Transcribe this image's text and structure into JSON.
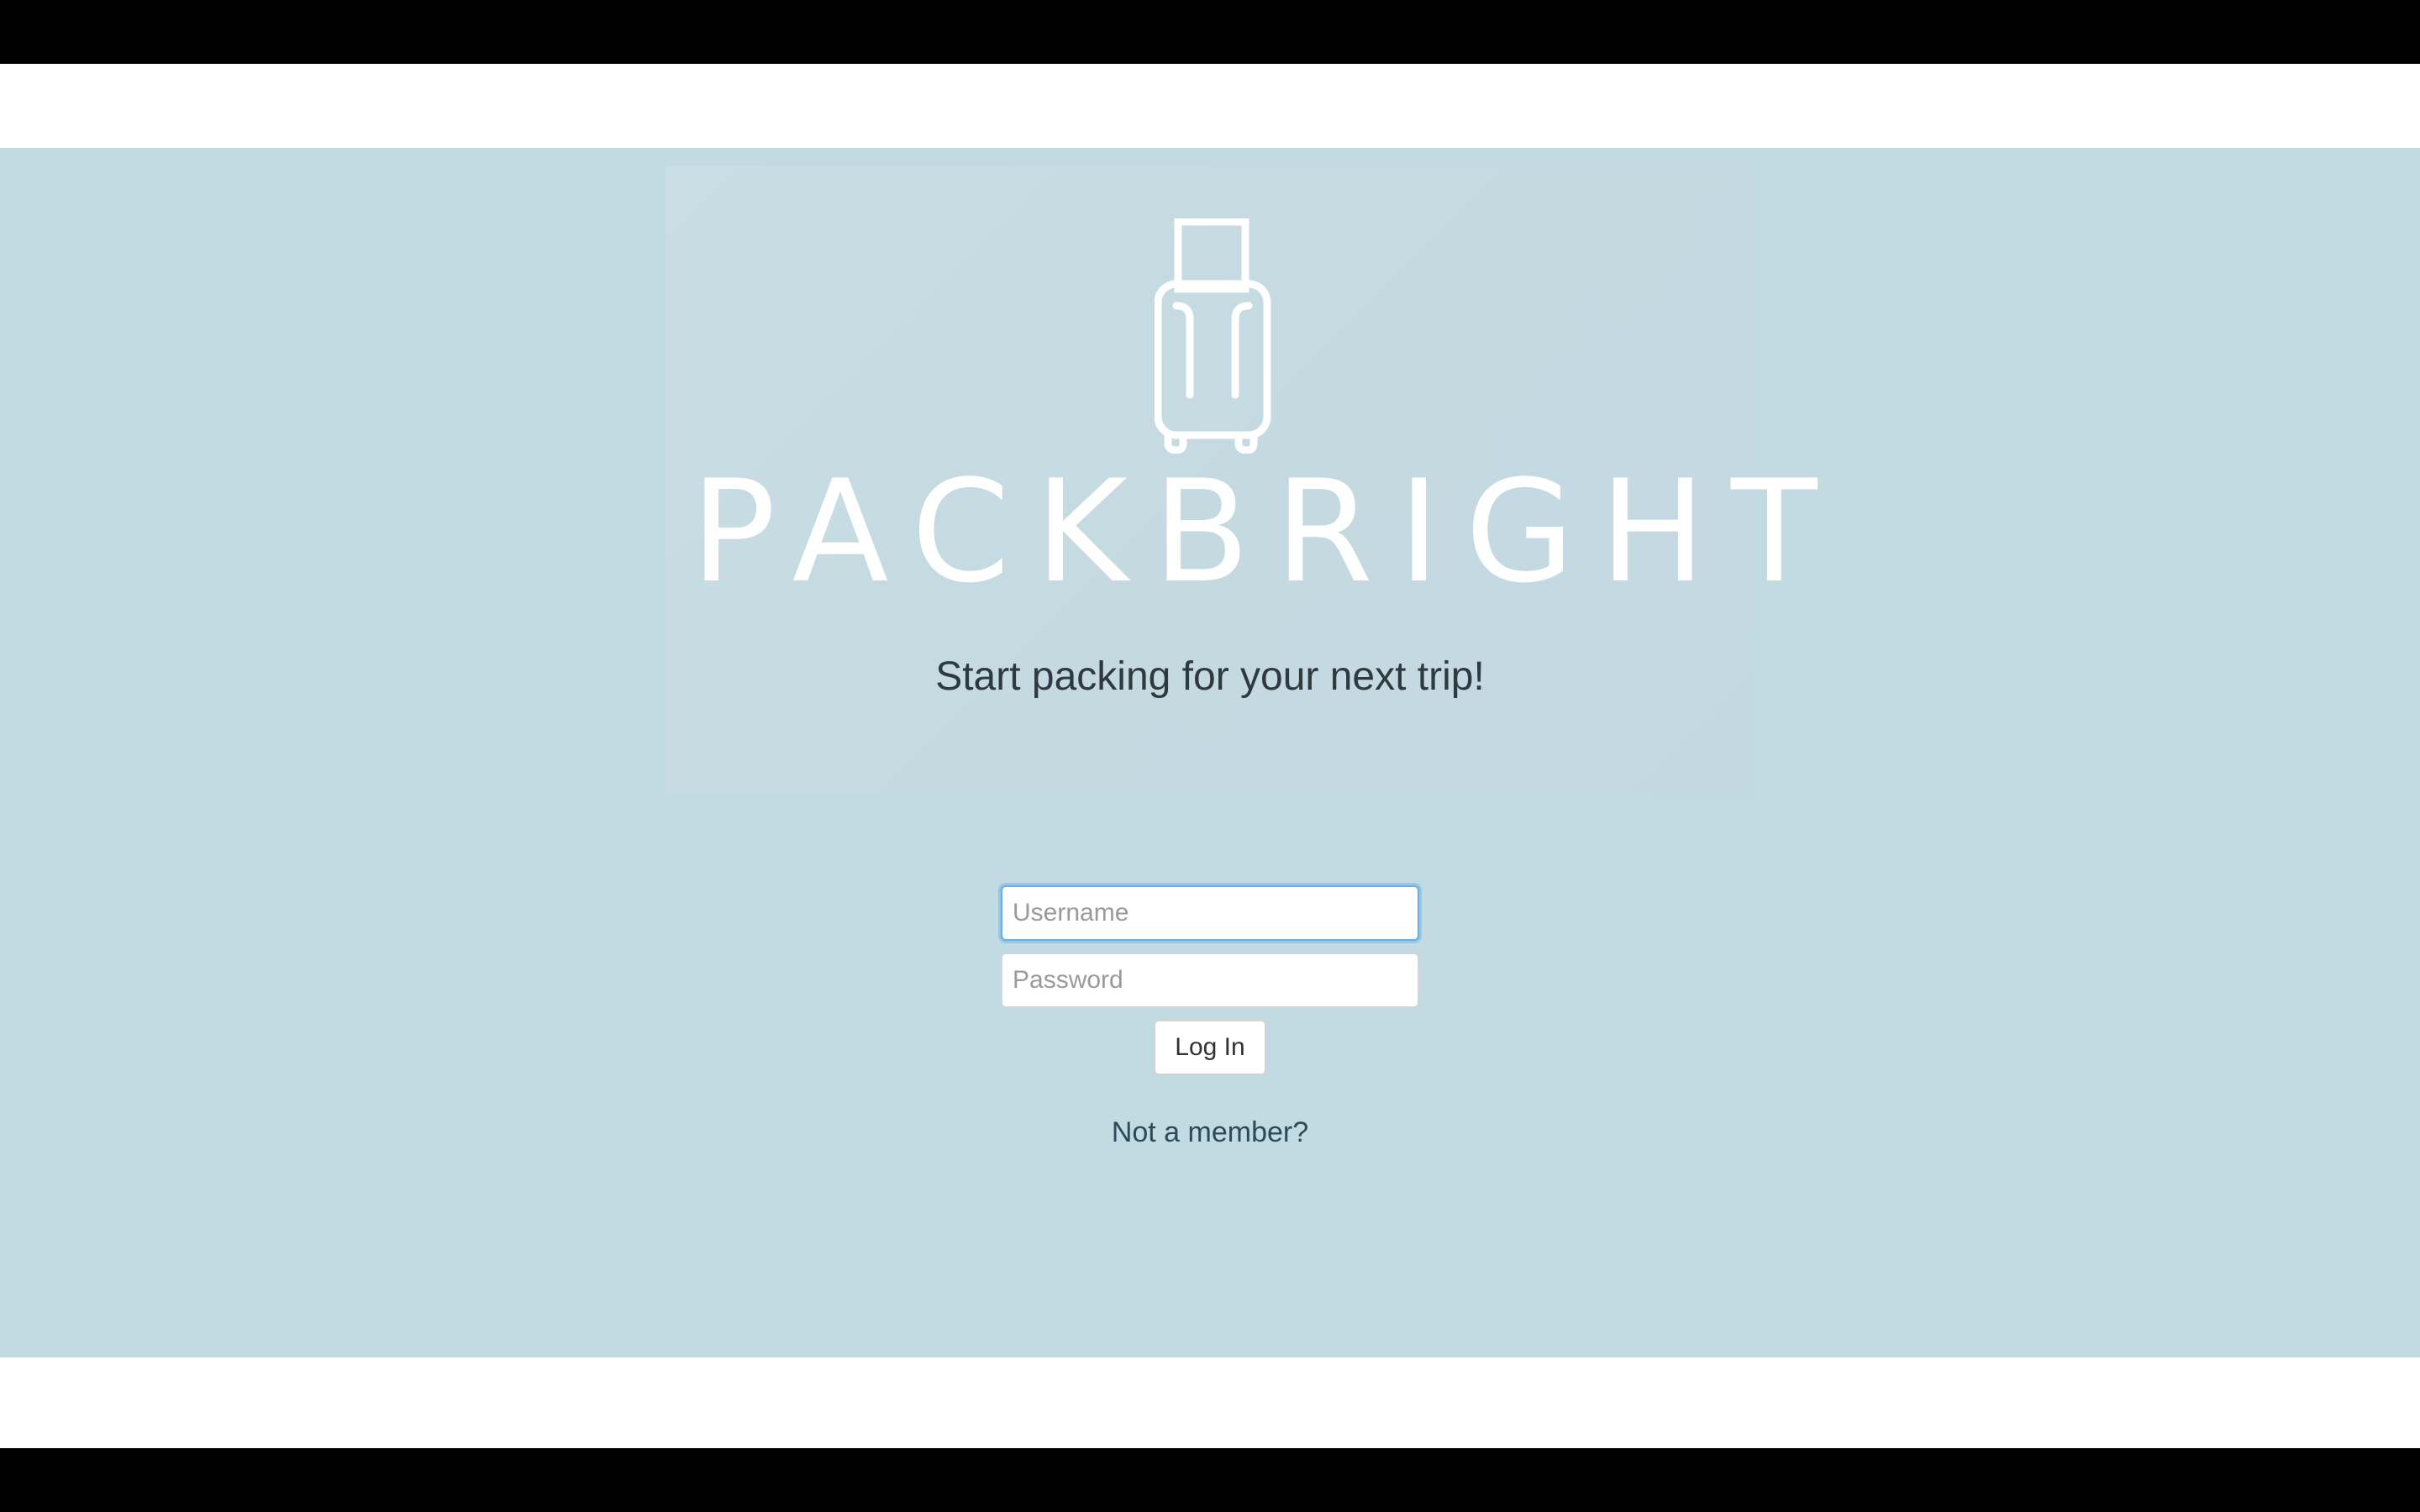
{
  "brand": {
    "name": "PACKBRIGHT",
    "logo_icon": "suitcase-icon"
  },
  "hero": {
    "tagline": "Start packing for your next trip!"
  },
  "login_form": {
    "username_placeholder": "Username",
    "password_placeholder": "Password",
    "submit_label": "Log In",
    "signup_link": "Not a member?"
  },
  "colors": {
    "hero_background": "#c2dae2",
    "text": "#2f3a3f",
    "link": "#2c4a5a",
    "focus_ring": "#66afe9"
  }
}
